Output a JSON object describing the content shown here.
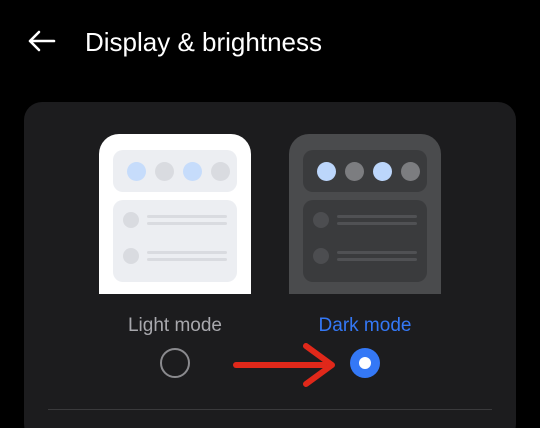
{
  "header": {
    "back_icon": "arrow-left-icon",
    "title": "Display & brightness"
  },
  "theme_options": [
    {
      "label": "Light mode",
      "selected": false,
      "label_color": "#a8a8ad",
      "preview_dot_colors": [
        "#c6dcfb",
        "#d9dbe0",
        "#c6dcfb",
        "#d9dbe0"
      ]
    },
    {
      "label": "Dark mode",
      "selected": true,
      "label_color": "#3478f6",
      "preview_dot_colors": [
        "#bcd6fb",
        "#7c7d80",
        "#bcd6fb",
        "#7c7d80"
      ]
    }
  ],
  "annotation": {
    "icon": "red-arrow-right-icon",
    "color": "#e0281a"
  },
  "colors": {
    "background": "#000000",
    "card": "#1c1c1e",
    "accent": "#3478f6",
    "text": "#ffffff"
  }
}
